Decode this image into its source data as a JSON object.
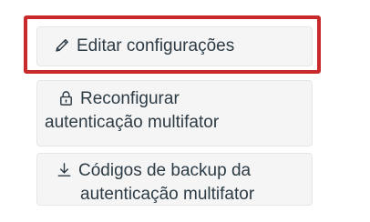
{
  "actions": {
    "edit_settings": {
      "label": "Editar configurações",
      "icon": "pencil-icon"
    },
    "reset_mfa": {
      "label_line1": "Reconfigurar",
      "label_line2": "autenticação multifator",
      "icon": "lock-icon"
    },
    "backup_codes": {
      "label_line1": "Códigos de backup da",
      "label_line2": "autenticação multifator",
      "icon": "download-icon"
    }
  },
  "colors": {
    "highlight_border": "#c8292b",
    "button_background": "#f5f5f5",
    "text": "#2d3b45"
  }
}
